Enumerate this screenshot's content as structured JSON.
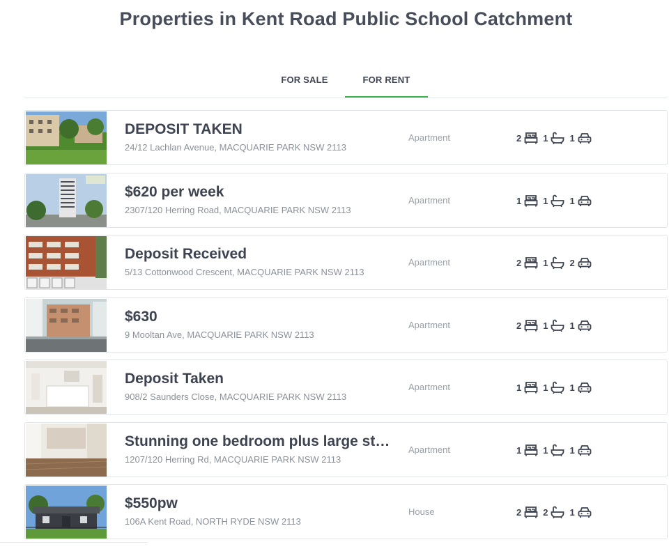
{
  "page": {
    "title": "Properties in Kent Road Public School Catchment"
  },
  "tabs": [
    {
      "label": "FOR SALE",
      "active": false
    },
    {
      "label": "FOR RENT",
      "active": true
    }
  ],
  "colors": {
    "accent": "#3cb34a",
    "text": "#3d4350",
    "muted": "#8b919b"
  },
  "icons": {
    "bed": "bed-icon",
    "bath": "bath-icon",
    "car": "car-icon"
  },
  "listings": [
    {
      "headline": "DEPOSIT TAKEN",
      "address": "24/12 Lachlan Avenue, MACQUARIE PARK NSW 2113",
      "type": "Apartment",
      "beds": "2",
      "baths": "1",
      "cars": "1"
    },
    {
      "headline": "$620 per week",
      "address": "2307/120 Herring Road, MACQUARIE PARK NSW 2113",
      "type": "Apartment",
      "beds": "1",
      "baths": "1",
      "cars": "1"
    },
    {
      "headline": "Deposit Received",
      "address": "5/13 Cottonwood Crescent, MACQUARIE PARK NSW 2113",
      "type": "Apartment",
      "beds": "2",
      "baths": "1",
      "cars": "2"
    },
    {
      "headline": "$630",
      "address": "9 Mooltan Ave, MACQUARIE PARK NSW 2113",
      "type": "Apartment",
      "beds": "2",
      "baths": "1",
      "cars": "1"
    },
    {
      "headline": "Deposit Taken",
      "address": "908/2 Saunders Close, MACQUARIE PARK NSW 2113",
      "type": "Apartment",
      "beds": "1",
      "baths": "1",
      "cars": "1"
    },
    {
      "headline": "Stunning one bedroom plus large stud...",
      "address": "1207/120 Herring Rd, MACQUARIE PARK NSW 2113",
      "type": "Apartment",
      "beds": "1",
      "baths": "1",
      "cars": "1"
    },
    {
      "headline": "$550pw",
      "address": "106A Kent Road, NORTH RYDE NSW 2113",
      "type": "House",
      "beds": "2",
      "baths": "2",
      "cars": "1"
    }
  ]
}
